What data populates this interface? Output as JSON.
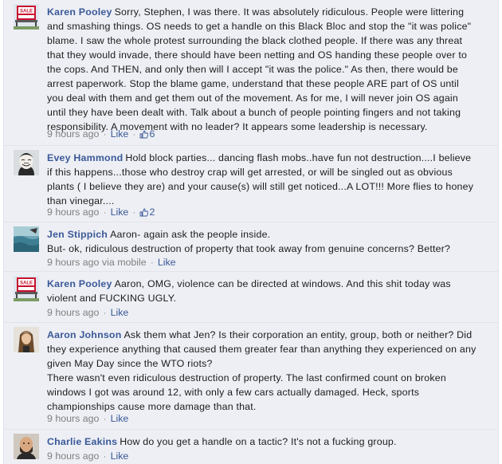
{
  "comments": [
    {
      "author": "Karen Pooley",
      "lines": [
        "Sorry, Stephen, I was there. It was absolutely ridiculous. People were littering",
        "and smashing things. OS needs to get a handle on this Black Bloc and stop the \"it was police\"",
        "blame. I saw the whole protest surrounding the black clothed people. If there was any threat",
        "that they would invade, there should have been netting and OS handing these people over to",
        "the cops. And THEN, and only then will I accept \"it was the police.\" As then, there would be",
        "arrest paperwork. Stop the blame game, understand that these people ARE part of OS until",
        "you deal with them and get them out of the movement. As for me, I will never join OS again",
        "until they have been dealt with. Talk about a bunch of people pointing fingers and not taking",
        "responsibility. A movement with no leader? It appears some leadership is necessary."
      ],
      "time": "9 hours ago",
      "via": "",
      "like_label": "Like",
      "like_count": "6",
      "avatar_icon": "for-sale-sign-avatar-icon"
    },
    {
      "author": "Evey Hammond",
      "lines": [
        "Hold block parties... dancing flash mobs..have fun not destruction....I believe",
        "if this happens...those who destroy crap will get arrested, or will be singled out as obvious",
        "plants ( I believe they are) and your cause(s) will still get noticed...A LOT!!! More flies to honey",
        "than vinegar...."
      ],
      "time": "9 hours ago",
      "via": "",
      "like_label": "Like",
      "like_count": "2",
      "avatar_icon": "masked-face-avatar-icon"
    },
    {
      "author": "Jen Stippich",
      "lines": [
        "Aaron- again ask the people inside.",
        "But- ok, ridiculous destruction of property that took away from genuine concerns? Better?"
      ],
      "time": "9 hours ago",
      "via": "via mobile",
      "like_label": "Like",
      "like_count": "",
      "avatar_icon": "water-photo-avatar-icon"
    },
    {
      "author": "Karen Pooley",
      "lines": [
        "Aaron, OMG, violence can be directed at windows. And this shit today was",
        "violent and FUCKING UGLY."
      ],
      "time": "9 hours ago",
      "via": "",
      "like_label": "Like",
      "like_count": "",
      "avatar_icon": "for-sale-sign-avatar-icon"
    },
    {
      "author": "Aaron Johnson",
      "lines": [
        "Ask them what Jen? Is their corporation an entity, group, both or neither? Did",
        "they experience anything that caused them greater fear than anything they experienced on any",
        "given May Day since the WTO riots?",
        "There wasn't even ridiculous destruction of property. The last confirmed count on broken",
        "windows I got was around 12, with only a few cars actually damaged. Heck, sports",
        "championships cause more damage than that."
      ],
      "time": "9 hours ago",
      "via": "",
      "like_label": "Like",
      "like_count": "",
      "avatar_icon": "long-hair-person-avatar-icon"
    },
    {
      "author": "Charlie Eakins",
      "lines": [
        "How do you get a handle on a tactic? It's not a fucking group."
      ],
      "time": "9 hours ago",
      "via": "",
      "like_label": "Like",
      "like_count": "",
      "avatar_icon": "bald-man-avatar-icon"
    }
  ],
  "colors": {
    "link": "#3b5998",
    "meta": "#808080",
    "background": "#edeff4"
  }
}
